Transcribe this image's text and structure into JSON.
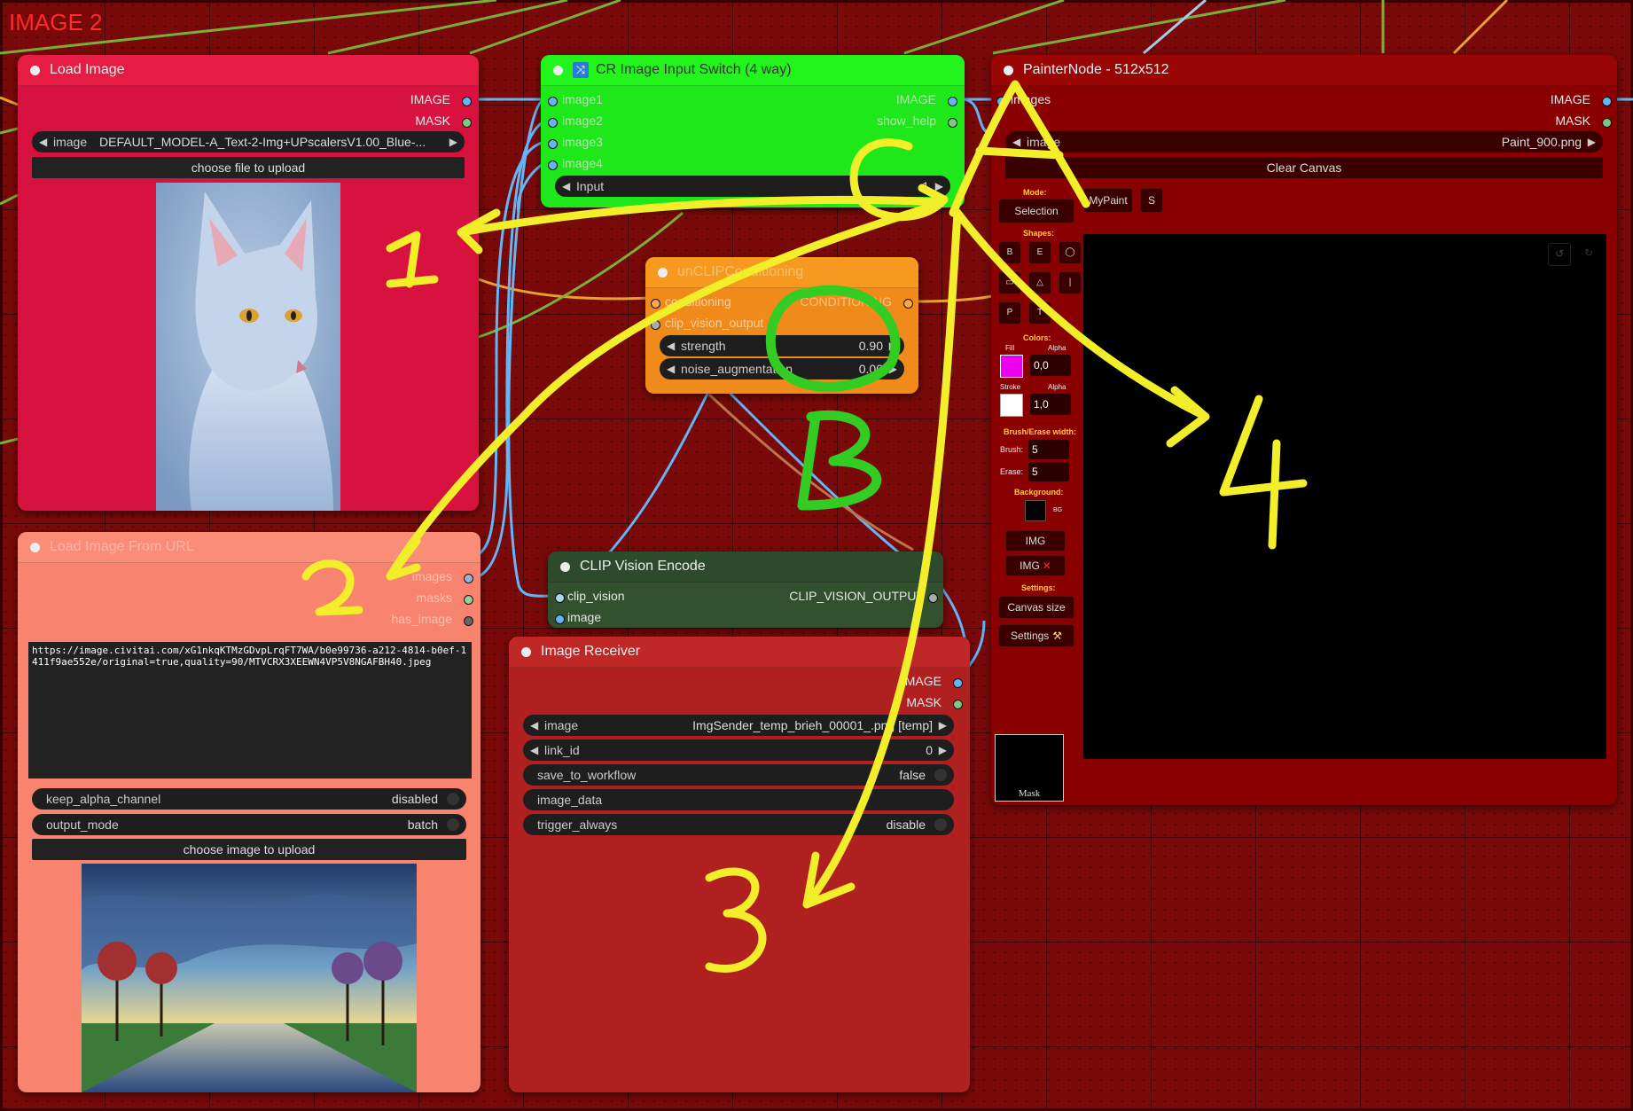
{
  "group": {
    "title": "IMAGE 2"
  },
  "load_image": {
    "title": "Load Image",
    "outputs": [
      "IMAGE",
      "MASK"
    ],
    "image_widget": {
      "label": "image",
      "value": "DEFAULT_MODEL-A_Text-2-Img+UPscalersV1.00_Blue-..."
    },
    "upload_button": "choose file to upload",
    "preview_icon": "blue-cat-portrait"
  },
  "cr_switch": {
    "title": "CR Image Input Switch (4 way)",
    "inputs": [
      "image1",
      "image2",
      "image3",
      "image4"
    ],
    "outputs": [
      "IMAGE",
      "show_help"
    ],
    "input_widget": {
      "label": "Input",
      "value": "1"
    }
  },
  "clip_cond": {
    "title": "unCLIPConditioning",
    "inputs": [
      "conditioning",
      "clip_vision_output"
    ],
    "output": "CONDITIONING",
    "strength": {
      "label": "strength",
      "value": "0.90"
    },
    "noise": {
      "label": "noise_augmentation",
      "value": "0.00"
    }
  },
  "painter": {
    "title": "PainterNode - 512x512",
    "input": "images",
    "outputs": [
      "IMAGE",
      "MASK"
    ],
    "image_widget": {
      "label": "image",
      "value": "Paint_900.png"
    },
    "clear_button": "Clear Canvas",
    "mode_label": "Mode:",
    "mode_value": "Selection",
    "mypaint_button": "MyPaint",
    "s_button": "S",
    "shapes_label": "Shapes:",
    "shape_tools": [
      "B",
      "E",
      "◯",
      "▭",
      "△",
      "|",
      "P",
      "T"
    ],
    "colors_label": "Colors:",
    "fill_label": "Fill",
    "alpha_label": "Alpha",
    "fill_color": "#ee00ee",
    "fill_alpha": "0,0",
    "stroke_label": "Stroke",
    "stroke_color": "#ffffff",
    "stroke_alpha": "1,0",
    "brush_erase_label": "Brush/Erase width:",
    "brush_label": "Brush:",
    "brush_value": "5",
    "erase_label": "Erase:",
    "erase_value": "5",
    "background_label": "Background:",
    "bg_color": "#000000",
    "bg_label": "BG",
    "img_button": "IMG",
    "img_x_button": "IMG",
    "settings_label": "Settings:",
    "canvas_size_button": "Canvas size",
    "settings_button": "Settings",
    "mask_label": "Mask"
  },
  "load_url": {
    "title": "Load Image From URL",
    "outputs": [
      "images",
      "masks",
      "has_image"
    ],
    "url": "https://image.civitai.com/xG1nkqKTMzGDvpLrqFT7WA/b0e99736-a212-4814-b0ef-1411f9ae552e/original=true,quality=90/MTVCRX3XEEWN4VP5V8NGAFBH40.jpeg",
    "keep_alpha": {
      "label": "keep_alpha_channel",
      "value": "disabled"
    },
    "output_mode": {
      "label": "output_mode",
      "value": "batch"
    },
    "upload_button": "choose image to upload",
    "preview_icon": "painted-tree-road"
  },
  "clip_vision": {
    "title": "CLIP Vision Encode",
    "inputs": [
      "clip_vision",
      "image"
    ],
    "output": "CLIP_VISION_OUTPUT"
  },
  "receiver": {
    "title": "Image Receiver",
    "outputs": [
      "IMAGE",
      "MASK"
    ],
    "image_widget": {
      "label": "image",
      "value": "ImgSender_temp_brieh_00001_.png [temp]"
    },
    "link_id": {
      "label": "link_id",
      "value": "0"
    },
    "save": {
      "label": "save_to_workflow",
      "value": "false"
    },
    "image_data": {
      "label": "image_data"
    },
    "trigger": {
      "label": "trigger_always",
      "value": "disable"
    }
  },
  "annotations": {
    "labels": [
      "1",
      "2",
      "3",
      "4",
      "A",
      "G",
      "O",
      "B"
    ],
    "color_yellow": "#f2ee2a",
    "color_green": "#33cc22"
  }
}
